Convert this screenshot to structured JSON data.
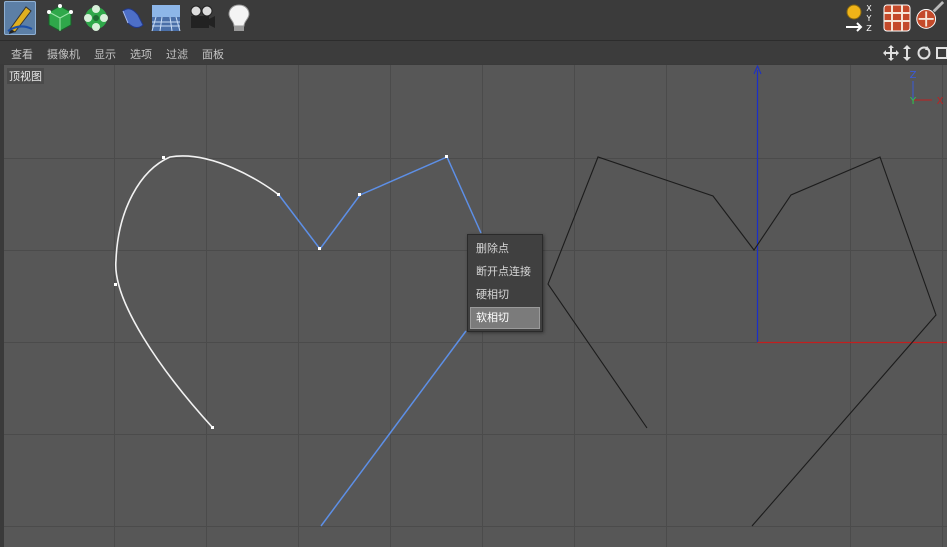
{
  "toolbar": {
    "left_tools": [
      {
        "name": "pen-tool",
        "icon": "pen-icon",
        "active": true
      },
      {
        "name": "cube-object",
        "icon": "cube-icon",
        "active": false
      },
      {
        "name": "subdivision-surface",
        "icon": "subdivision-icon",
        "active": false
      },
      {
        "name": "extrude-generator",
        "icon": "extrude-icon",
        "active": false
      },
      {
        "name": "floor-environment",
        "icon": "floor-icon",
        "active": false
      },
      {
        "name": "camera-object",
        "icon": "camera-icon",
        "active": false
      },
      {
        "name": "light-object",
        "icon": "lightbulb-icon",
        "active": false
      }
    ],
    "right_tools": [
      {
        "name": "coordinate-system",
        "icon": "xyz-coordinate-icon",
        "letters": "XYZ"
      },
      {
        "name": "render-view",
        "icon": "render-pattern-icon"
      },
      {
        "name": "render-settings",
        "icon": "render-settings-icon"
      }
    ]
  },
  "menubar": {
    "items": [
      "查看",
      "摄像机",
      "显示",
      "选项",
      "过滤",
      "面板"
    ]
  },
  "viewport": {
    "label": "顶视图",
    "axis_labels": {
      "z": "Z",
      "y": "Y",
      "x": "X"
    }
  },
  "context_menu": {
    "items": [
      "删除点",
      "断开点连接",
      "硬相切",
      "软相切"
    ],
    "highlighted_index": 3
  },
  "colors": {
    "toolbar_bg": "#3b3b3b",
    "viewport_bg": "#575757",
    "grid_line": "#4a4a4a",
    "spline_selected": "#5d8fe6",
    "spline_white": "#f2f2f2",
    "spline_black": "#1c1c1c",
    "axis_blue": "#1b2fc9",
    "axis_red": "#c21f1f",
    "axis_green": "#2fc94a"
  }
}
